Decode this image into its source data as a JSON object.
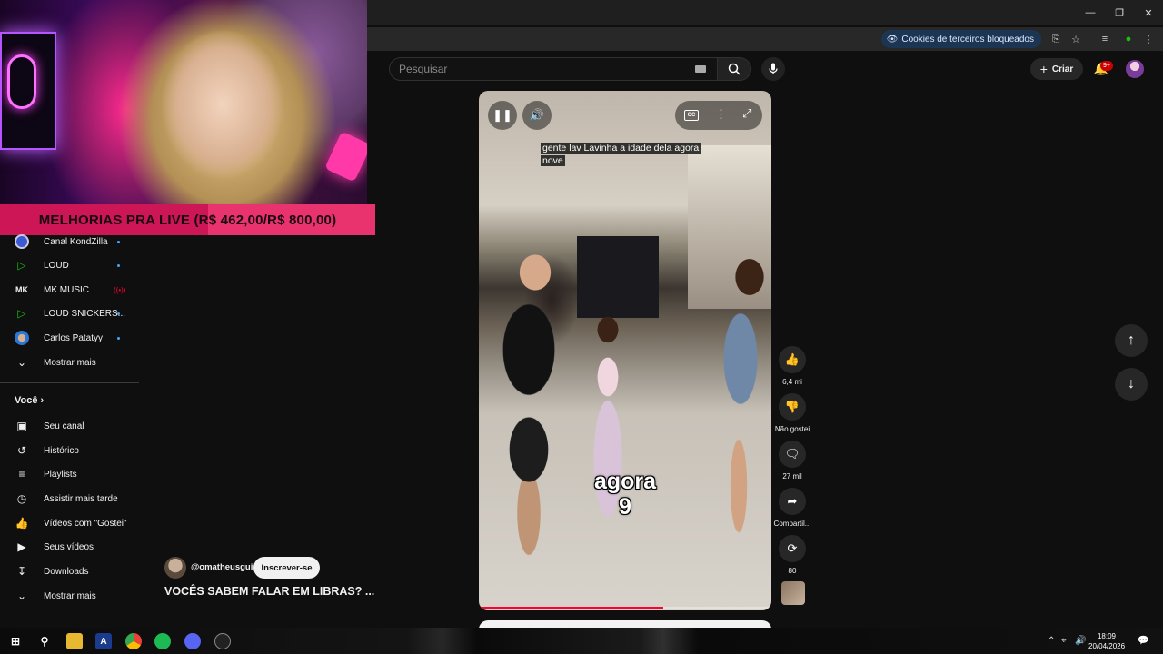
{
  "browser": {
    "cookie_status": "Cookies de terceiros bloqueados"
  },
  "header": {
    "search_placeholder": "Pesquisar",
    "create_label": "Criar",
    "notification_count": "9+"
  },
  "overlay": {
    "goal_text": "MELHORIAS PRA LIVE (R$ 462,00/R$ 800,00)",
    "goal_current": 462,
    "goal_target": 800
  },
  "sidebar": {
    "subscriptions": [
      {
        "label": "Canal KondZilla",
        "color": "#3b5bd4",
        "indicator": "dot"
      },
      {
        "label": "LOUD",
        "color": "#16c60c",
        "indicator": "dot"
      },
      {
        "label": "MK MUSIC",
        "color": "#ffffff",
        "indicator": "live"
      },
      {
        "label": "LOUD SNICKERS...",
        "color": "#16c60c",
        "indicator": "dot"
      },
      {
        "label": "Carlos Patatyy",
        "color": "#2a78d6",
        "indicator": "dot"
      }
    ],
    "show_more_1": "Mostrar mais",
    "you_header": "Você",
    "you_items": [
      {
        "label": "Seu canal",
        "icon": "person-box-icon"
      },
      {
        "label": "Histórico",
        "icon": "history-icon"
      },
      {
        "label": "Playlists",
        "icon": "playlist-icon"
      },
      {
        "label": "Assistir mais tarde",
        "icon": "clock-icon"
      },
      {
        "label": "Vídeos com \"Gostei\"",
        "icon": "thumbs-up-icon"
      },
      {
        "label": "Seus vídeos",
        "icon": "video-icon"
      },
      {
        "label": "Downloads",
        "icon": "download-icon"
      }
    ],
    "show_more_2": "Mostrar mais"
  },
  "player": {
    "caption_text": "gente lav Lavinha a idade dela agora nove",
    "burned_line1": "agora",
    "burned_line2": "9",
    "progress": 0.63
  },
  "actions": {
    "likes": "6,4 mi",
    "dislike_label": "Não gostei",
    "comments": "27 mil",
    "share_label": "Compartil...",
    "remix_count": "80"
  },
  "channel": {
    "handle": "@omatheusgui",
    "subscribe_label": "Inscrever-se",
    "video_title": "VOCÊS SABEM FALAR EM LIBRAS? ..."
  },
  "taskbar": {
    "time": "18:09",
    "date": "20/04/2026"
  }
}
